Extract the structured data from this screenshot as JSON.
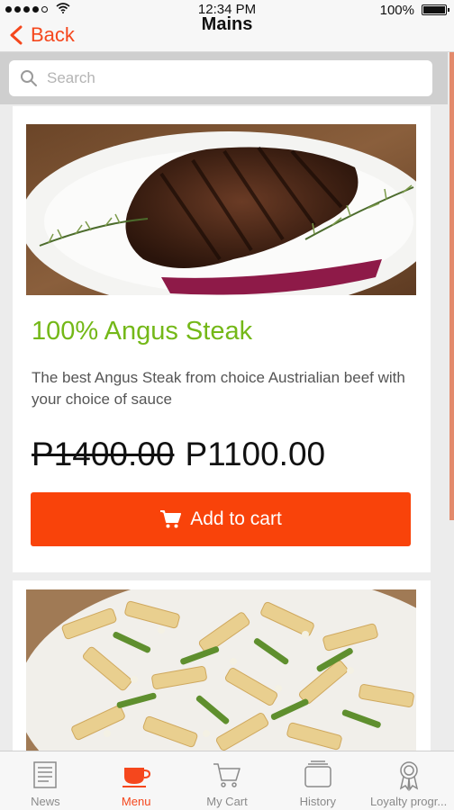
{
  "status_bar": {
    "time": "12:34 PM",
    "battery": "100%"
  },
  "nav": {
    "back_label": "Back",
    "title": "Mains"
  },
  "search": {
    "placeholder": "Search"
  },
  "items": [
    {
      "name": "100% Angus Steak",
      "description": "The best Angus Steak from choice Austrialian beef with your choice of sauce",
      "old_price": "P1400.00",
      "price": "P1100.00",
      "button_label": "Add to cart"
    }
  ],
  "colors": {
    "accent": "#f9430a",
    "name_green": "#74b818"
  },
  "tabs": [
    {
      "label": "News",
      "icon": "newspaper-icon"
    },
    {
      "label": "Menu",
      "icon": "cup-icon",
      "active": true
    },
    {
      "label": "My Cart",
      "icon": "cart-icon"
    },
    {
      "label": "History",
      "icon": "history-icon"
    },
    {
      "label": "Loyalty progr...",
      "icon": "award-icon"
    }
  ]
}
